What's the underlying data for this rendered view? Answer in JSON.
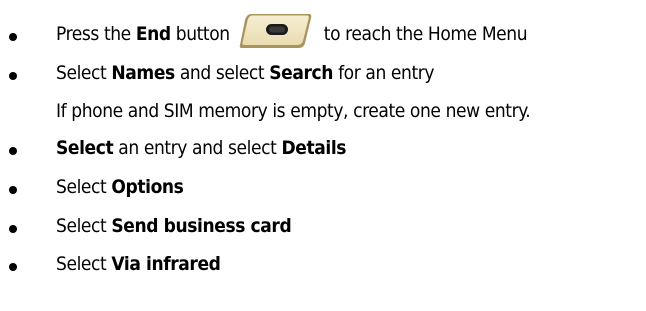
{
  "instructions": [
    {
      "id": "step-1",
      "bullet": true,
      "segments": [
        {
          "text": "Press the ",
          "bold": false
        },
        {
          "text": "End",
          "bold": true
        },
        {
          "text": " button ",
          "bold": false
        },
        {
          "icon": "end-key-icon"
        },
        {
          "text": " to reach the Home Menu",
          "bold": false
        }
      ]
    },
    {
      "id": "step-2",
      "bullet": true,
      "segments": [
        {
          "text": "Select ",
          "bold": false
        },
        {
          "text": "Names",
          "bold": true
        },
        {
          "text": " and select ",
          "bold": false
        },
        {
          "text": "Search",
          "bold": true
        },
        {
          "text": " for an entry",
          "bold": false
        }
      ]
    },
    {
      "id": "step-2-note",
      "bullet": false,
      "segments": [
        {
          "text": "If phone and SIM memory is empty, create one new entry.",
          "bold": false
        }
      ]
    },
    {
      "id": "step-3",
      "bullet": true,
      "segments": [
        {
          "text": "Select",
          "bold": true
        },
        {
          "text": " an entry and select ",
          "bold": false
        },
        {
          "text": "Details",
          "bold": true
        }
      ]
    },
    {
      "id": "step-4",
      "bullet": true,
      "segments": [
        {
          "text": "Select ",
          "bold": false
        },
        {
          "text": "Options",
          "bold": true
        }
      ]
    },
    {
      "id": "step-5",
      "bullet": true,
      "segments": [
        {
          "text": "Select ",
          "bold": false
        },
        {
          "text": "Send business card",
          "bold": true
        }
      ]
    },
    {
      "id": "step-6",
      "bullet": true,
      "segments": [
        {
          "text": "Select ",
          "bold": false
        },
        {
          "text": "Via infrared",
          "bold": true
        }
      ]
    }
  ],
  "colors": {
    "text": "#000000",
    "background": "#ffffff",
    "key_face": "#e9dcb0",
    "key_edge": "#a8955e"
  }
}
